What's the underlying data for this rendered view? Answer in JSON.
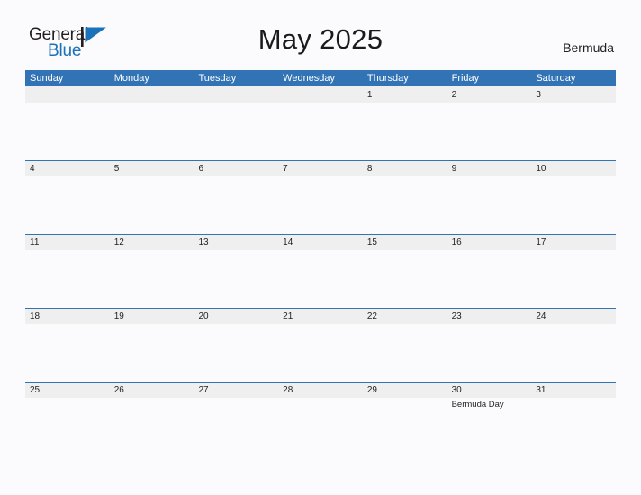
{
  "brand": {
    "word_one": "General",
    "word_two": "Blue",
    "flag_icon": "blue-triangle-flag-icon",
    "colors": {
      "text_dark": "#231f20",
      "blue": "#1b72b8"
    }
  },
  "header": {
    "title": "May 2025",
    "region": "Bermuda"
  },
  "theme": {
    "header_blue": "#3173b5",
    "date_band_gray": "#efefef",
    "page_background": "#fbfafc",
    "text": "#231f20"
  },
  "calendar": {
    "day_headers": [
      "Sunday",
      "Monday",
      "Tuesday",
      "Wednesday",
      "Thursday",
      "Friday",
      "Saturday"
    ],
    "weeks": [
      {
        "dates": [
          "",
          "",
          "",
          "",
          "1",
          "2",
          "3"
        ],
        "events": [
          "",
          "",
          "",
          "",
          "",
          "",
          ""
        ]
      },
      {
        "dates": [
          "4",
          "5",
          "6",
          "7",
          "8",
          "9",
          "10"
        ],
        "events": [
          "",
          "",
          "",
          "",
          "",
          "",
          ""
        ]
      },
      {
        "dates": [
          "11",
          "12",
          "13",
          "14",
          "15",
          "16",
          "17"
        ],
        "events": [
          "",
          "",
          "",
          "",
          "",
          "",
          ""
        ]
      },
      {
        "dates": [
          "18",
          "19",
          "20",
          "21",
          "22",
          "23",
          "24"
        ],
        "events": [
          "",
          "",
          "",
          "",
          "",
          "",
          ""
        ]
      },
      {
        "dates": [
          "25",
          "26",
          "27",
          "28",
          "29",
          "30",
          "31"
        ],
        "events": [
          "",
          "",
          "",
          "",
          "",
          "Bermuda Day",
          ""
        ]
      }
    ]
  }
}
